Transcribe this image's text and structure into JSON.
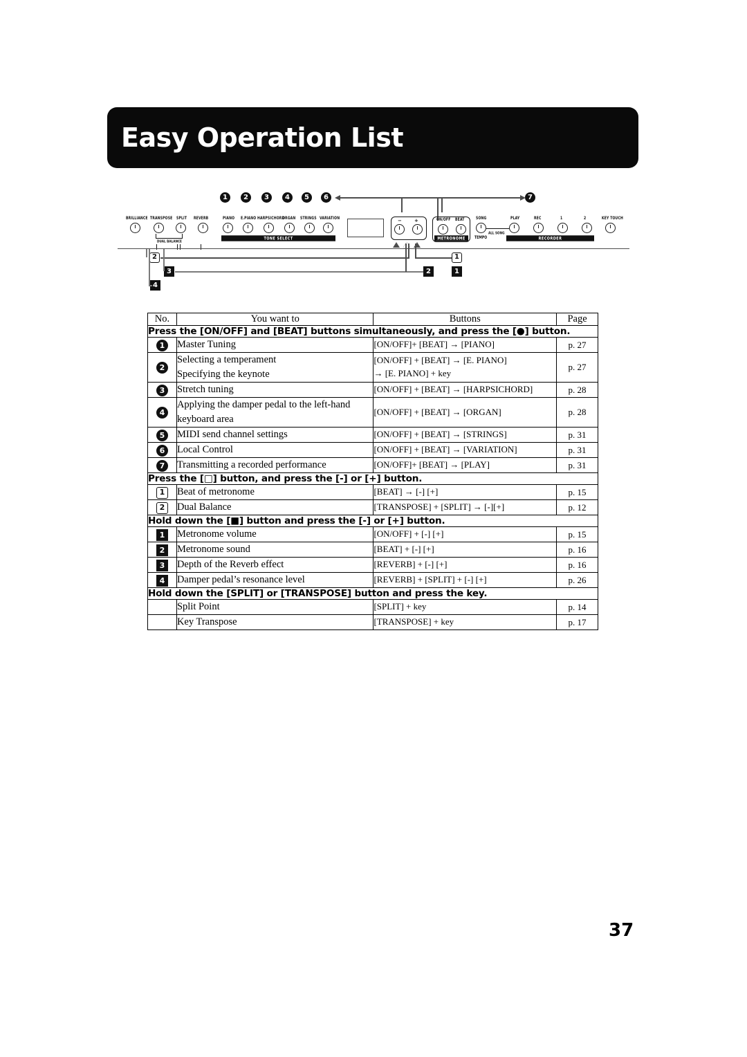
{
  "page": {
    "title": "Easy Operation List",
    "page_number": "37"
  },
  "diagram": {
    "top_callouts": [
      "1",
      "2",
      "3",
      "4",
      "5",
      "6",
      "7"
    ],
    "bottom_callouts": {
      "square_2": "2",
      "square_3": "3",
      "square_4": "4",
      "square_right_1": "1",
      "square_right_2": "2",
      "fill_right_1": "1"
    },
    "left_knobs": [
      "BRILLIANCE",
      "TRANSPOSE",
      "SPLIT",
      "REVERB"
    ],
    "dual_balance_label": "DUAL BALANCE",
    "tone_knobs": [
      "PIANO",
      "E.PIANO",
      "HARPSICHORD",
      "ORGAN",
      "STRINGS",
      "VARIATION"
    ],
    "tone_select_label": "TONE SELECT",
    "minus_label": "−",
    "plus_label": "+",
    "metronome_knobs": [
      "ON/OFF",
      "BEAT"
    ],
    "metronome_label": "METRONOME",
    "song_label": "SONG",
    "all_song_label": "ALL SONG",
    "tempo_label": "TEMPO",
    "recorder_knobs": [
      "PLAY",
      "REC",
      "1",
      "2",
      "KEY TOUCH"
    ],
    "recorder_label": "RECORDER"
  },
  "table": {
    "headers": {
      "no": "No.",
      "want": "You want to",
      "buttons": "Buttons",
      "page": "Page"
    },
    "sections": [
      {
        "heading": "Press the [ON/OFF] and [BEAT] buttons simultaneously, and press the [●] button.",
        "badge_style": "circle",
        "rows": [
          {
            "no": "1",
            "want": "Master Tuning",
            "buttons": "[ON/OFF]+ [BEAT] → [PIANO]",
            "page": "p. 27"
          },
          {
            "no": "2",
            "want": "Selecting a temperament\nSpecifying the keynote",
            "buttons": "[ON/OFF] + [BEAT] → [E. PIANO]\n→ [E. PIANO] + key",
            "page": "p. 27"
          },
          {
            "no": "3",
            "want": "Stretch tuning",
            "buttons": "[ON/OFF] + [BEAT] → [HARPSICHORD]",
            "page": "p. 28"
          },
          {
            "no": "4",
            "want": "Applying the damper pedal to the left-hand\nkeyboard area",
            "buttons": "[ON/OFF] + [BEAT] → [ORGAN]",
            "page": "p. 28"
          },
          {
            "no": "5",
            "want": "MIDI send channel settings",
            "buttons": "[ON/OFF] + [BEAT] → [STRINGS]",
            "page": "p. 31"
          },
          {
            "no": "6",
            "want": "Local Control",
            "buttons": "[ON/OFF] + [BEAT] → [VARIATION]",
            "page": "p. 31"
          },
          {
            "no": "7",
            "want": "Transmitting a recorded performance",
            "buttons": "[ON/OFF]+ [BEAT] → [PLAY]",
            "page": "p. 31"
          }
        ]
      },
      {
        "heading": "Press the [□] button, and press the [-] or [+] button.",
        "badge_style": "square-outline",
        "rows": [
          {
            "no": "1",
            "want": "Beat of metronome",
            "buttons": "[BEAT] → [-] [+]",
            "page": "p. 15"
          },
          {
            "no": "2",
            "want": "Dual Balance",
            "buttons": "[TRANSPOSE] + [SPLIT] → [-][+]",
            "page": "p. 12"
          }
        ]
      },
      {
        "heading": "Hold down the [■] button and press the [-] or [+] button.",
        "badge_style": "square-fill",
        "rows": [
          {
            "no": "1",
            "want": "Metronome volume",
            "buttons": "[ON/OFF] + [-] [+]",
            "page": "p. 15"
          },
          {
            "no": "2",
            "want": "Metronome sound",
            "buttons": "[BEAT] + [-] [+]",
            "page": "p. 16"
          },
          {
            "no": "3",
            "want": "Depth of the Reverb effect",
            "buttons": "[REVERB] + [-] [+]",
            "page": "p. 16"
          },
          {
            "no": "4",
            "want": "Damper pedal’s resonance level",
            "buttons": "[REVERB] + [SPLIT] + [-] [+]",
            "page": "p. 26"
          }
        ]
      },
      {
        "heading": "Hold down the [SPLIT] or [TRANSPOSE] button and press the key.",
        "badge_style": "none",
        "rows": [
          {
            "no": "",
            "want": "Split Point",
            "buttons": "[SPLIT] + key",
            "page": "p. 14"
          },
          {
            "no": "",
            "want": "Key Transpose",
            "buttons": "[TRANSPOSE] + key",
            "page": "p. 17"
          }
        ]
      }
    ]
  }
}
